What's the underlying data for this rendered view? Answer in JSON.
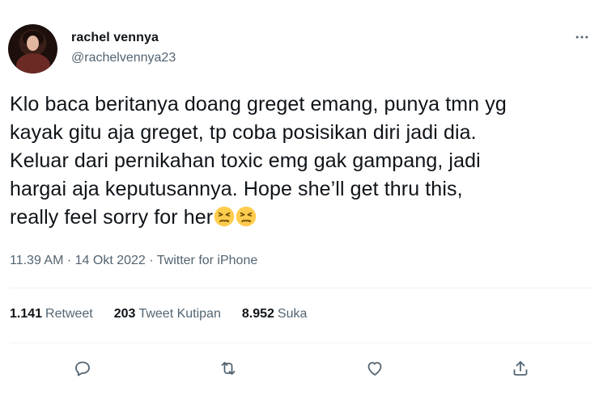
{
  "author": {
    "display_name": "rachel vennya",
    "handle": "@rachelvennya23"
  },
  "tweet": {
    "text": "Klo baca beritanya doang greget emang, punya tmn yg\nkayak gitu aja greget, tp coba posisikan diri jadi dia.\nKeluar dari pernikahan toxic emg gak gampang, jadi\nhargai aja keputusannya. Hope she’ll get thru this,\nreally feel sorry for her",
    "emojis": [
      "tired-face-emoji",
      "tired-face-emoji"
    ]
  },
  "meta": {
    "time": "11.39 AM",
    "sep1": " · ",
    "date": "14 Okt 2022",
    "sep2": " · ",
    "source": "Twitter for iPhone"
  },
  "stats": {
    "retweets_count": "1.141",
    "retweets_label": "Retweet",
    "quotes_count": "203",
    "quotes_label": "Tweet Kutipan",
    "likes_count": "8.952",
    "likes_label": "Suka"
  },
  "icons": {
    "more": "more-icon",
    "reply": "reply-icon",
    "retweet": "retweet-icon",
    "like": "like-icon",
    "share": "share-icon"
  },
  "colors": {
    "text": "#0f1419",
    "secondary": "#536471",
    "divider": "#eff3f4",
    "emoji_face": "#ffcc4d"
  }
}
